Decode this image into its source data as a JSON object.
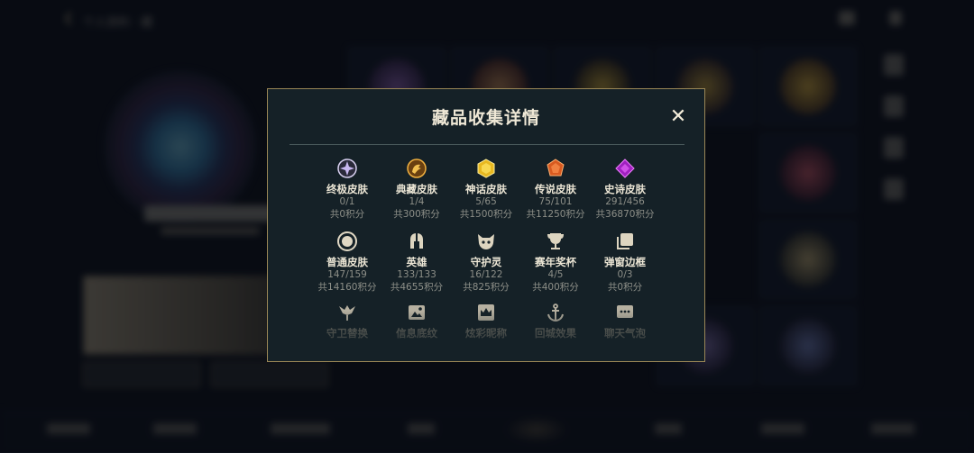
{
  "header": {
    "breadcrumb": "个人资料 · 藏"
  },
  "dialog": {
    "title": "藏品收集详情",
    "close_label": "✕",
    "rows": [
      [
        {
          "label": "终极皮肤",
          "count": "0/1",
          "points": "共0积分",
          "icon": "ultimate-skin-icon",
          "color": "#b9a8e8"
        },
        {
          "label": "典藏皮肤",
          "count": "1/4",
          "points": "共300积分",
          "icon": "prestige-skin-icon",
          "color": "#e0a24a"
        },
        {
          "label": "神话皮肤",
          "count": "5/65",
          "points": "共1500积分",
          "icon": "mythic-skin-icon",
          "color": "#f1c232"
        },
        {
          "label": "传说皮肤",
          "count": "75/101",
          "points": "共11250积分",
          "icon": "legendary-skin-icon",
          "color": "#e8702a"
        },
        {
          "label": "史诗皮肤",
          "count": "291/456",
          "points": "共36870积分",
          "icon": "epic-skin-icon",
          "color": "#b03ac8"
        }
      ],
      [
        {
          "label": "普通皮肤",
          "count": "147/159",
          "points": "共14160积分",
          "icon": "common-skin-icon",
          "color": "#d9d2bd"
        },
        {
          "label": "英雄",
          "count": "133/133",
          "points": "共4655积分",
          "icon": "champion-helmet-icon",
          "color": "#d9d2bd"
        },
        {
          "label": "守护灵",
          "count": "16/122",
          "points": "共825积分",
          "icon": "guardian-spirit-icon",
          "color": "#d9d2bd"
        },
        {
          "label": "赛年奖杯",
          "count": "4/5",
          "points": "共400积分",
          "icon": "trophy-icon",
          "color": "#d9d2bd"
        },
        {
          "label": "弹窗边框",
          "count": "0/3",
          "points": "共0积分",
          "icon": "popup-frame-icon",
          "color": "#d9d2bd"
        }
      ],
      [
        {
          "label": "守卫替换",
          "icon": "ward-skin-icon",
          "color": "#b6b0a0"
        },
        {
          "label": "信息底纹",
          "icon": "info-card-icon",
          "color": "#b6b0a0"
        },
        {
          "label": "炫彩昵称",
          "icon": "crown-name-icon",
          "color": "#b6b0a0"
        },
        {
          "label": "回城效果",
          "icon": "recall-anchor-icon",
          "color": "#b6b0a0"
        },
        {
          "label": "聊天气泡",
          "icon": "chat-bubble-icon",
          "color": "#b6b0a0"
        }
      ]
    ]
  }
}
